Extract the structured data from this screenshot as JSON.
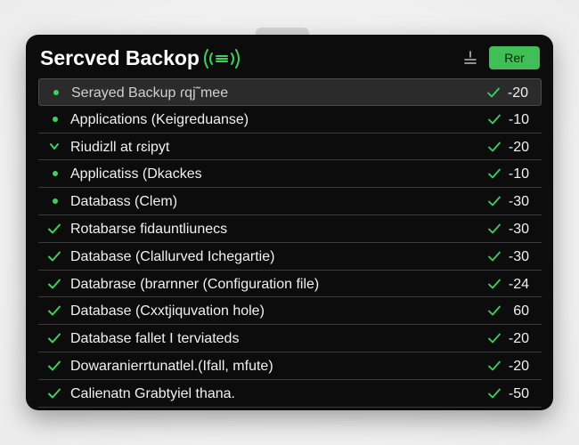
{
  "window": {
    "title": "Sercved Backop",
    "action_label": "Rer"
  },
  "colors": {
    "accent": "#3fbf55",
    "panel_bg": "#0c0c0c",
    "text": "#f1f1f1"
  },
  "icons": {
    "title_icon": "signal-waves-icon",
    "sort_icon": "sort-icon",
    "row_bullet": "dot-icon",
    "row_check": "check-icon",
    "row_arrow": "arrow-icon"
  },
  "rows": [
    {
      "marker": "dot",
      "label": "Serayed Backup ɾqj˜mee",
      "value": "-20"
    },
    {
      "marker": "dot",
      "label": "Applications (Keigreduanse)",
      "value": "-10"
    },
    {
      "marker": "arrow",
      "label": "Riudizll at ɾɛipyt",
      "value": "-20"
    },
    {
      "marker": "dot",
      "label": "Applicatiss (Dkackes",
      "value": "-10"
    },
    {
      "marker": "dot",
      "label": "Databass (Clem)",
      "value": "-30"
    },
    {
      "marker": "check",
      "label": "Rotabarse fidauntliunecs",
      "value": "-30"
    },
    {
      "marker": "check",
      "label": "Database (Clallurved Ichegartie)",
      "value": "-30"
    },
    {
      "marker": "check",
      "label": "Databrase (brarnner (Configuration file)",
      "value": "-24"
    },
    {
      "marker": "check",
      "label": "Database (Cxxtjiquvation hole)",
      "value": "60"
    },
    {
      "marker": "check",
      "label": "Database fallet I terviateds",
      "value": "-20"
    },
    {
      "marker": "check",
      "label": "Dowaranierrtunatlel.(Ifall, mfute)",
      "value": "-20"
    },
    {
      "marker": "check",
      "label": "Calienatn Grabtyiel thana.",
      "value": "-50"
    }
  ]
}
